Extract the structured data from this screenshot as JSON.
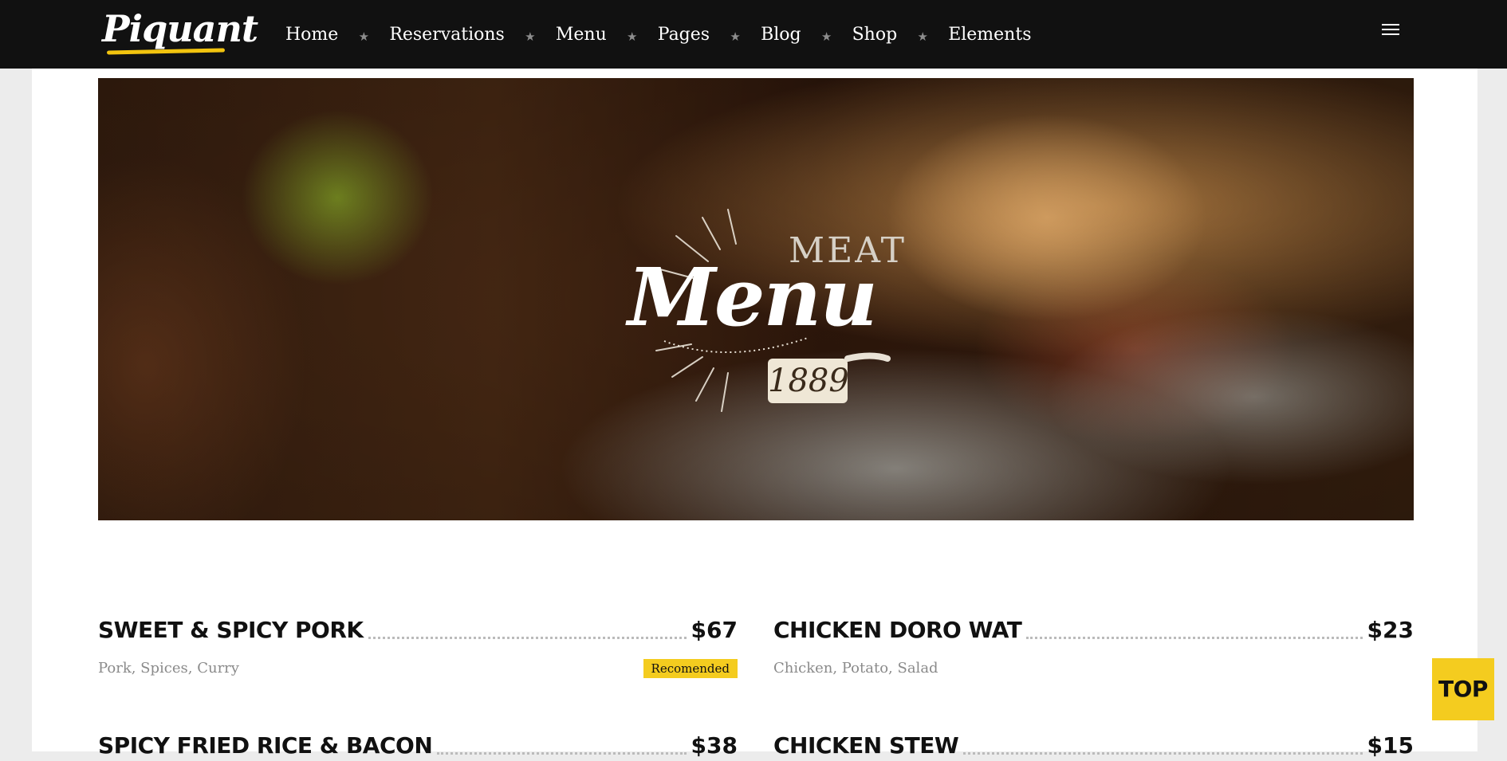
{
  "brand": {
    "logo_text": "Piquant"
  },
  "nav": {
    "items": [
      {
        "label": "Home"
      },
      {
        "label": "Reservations"
      },
      {
        "label": "Menu"
      },
      {
        "label": "Pages"
      },
      {
        "label": "Blog"
      },
      {
        "label": "Shop"
      },
      {
        "label": "Elements"
      }
    ],
    "separator_icon": "star-icon",
    "menu_icon": "hamburger-menu-icon"
  },
  "hero": {
    "badge": {
      "top_word": "MEAT",
      "main_word": "Menu",
      "year": "1889"
    }
  },
  "menu": {
    "items": [
      {
        "name": "SWEET & SPICY PORK",
        "price": "$67",
        "description": "Pork, Spices, Curry",
        "badge": "Recomended"
      },
      {
        "name": "CHICKEN DORO WAT",
        "price": "$23",
        "description": "Chicken, Potato, Salad"
      },
      {
        "name": "SPICY FRIED RICE & BACON",
        "price": "$38"
      },
      {
        "name": "CHICKEN STEW",
        "price": "$15"
      }
    ]
  },
  "back_to_top": {
    "label": "TOP"
  },
  "colors": {
    "accent": "#f4cc1f",
    "nav_bg": "#111111",
    "text": "#111111",
    "muted": "#8a8a8a"
  }
}
